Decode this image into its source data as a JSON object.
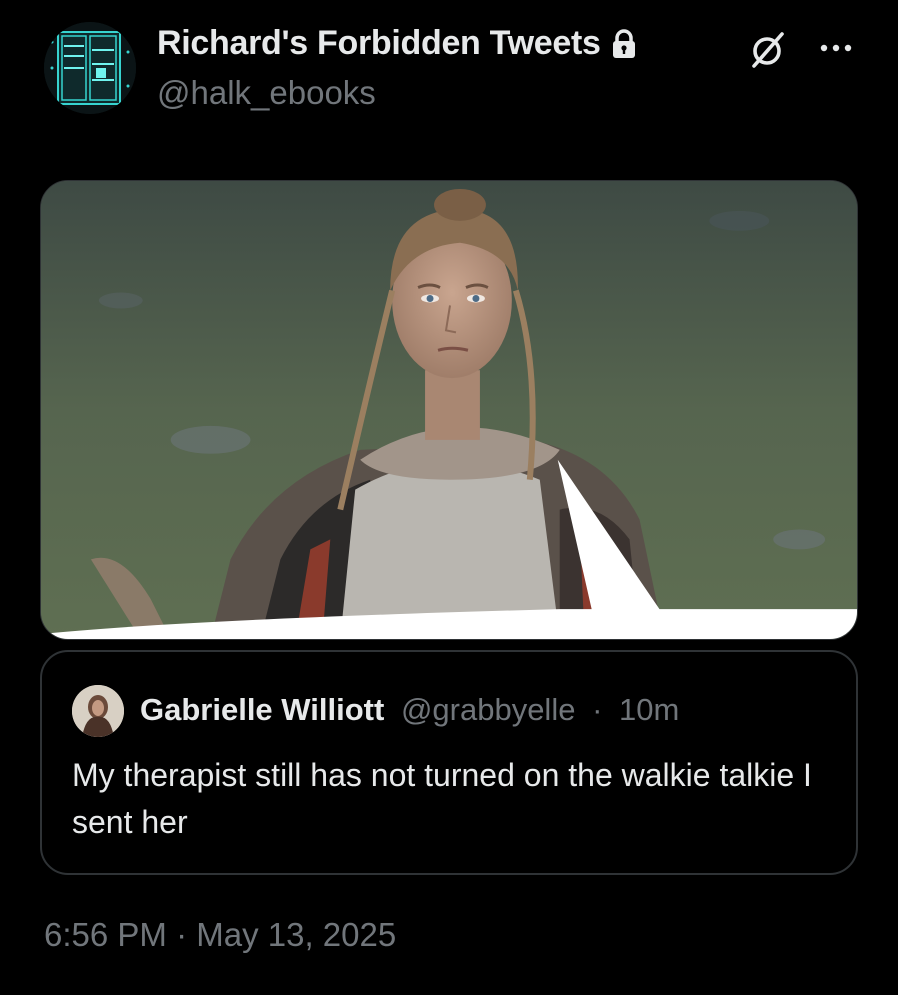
{
  "author": {
    "display_name": "Richard's Forbidden Tweets",
    "handle": "@halk_ebooks",
    "avatar_icon": "book-scan-avatar",
    "protected_icon": "lock-icon"
  },
  "actions": {
    "grok_icon": "grok-icon",
    "more_icon": "more-icon"
  },
  "media": {
    "type": "image",
    "speech_bubble_icon": "speech-bubble-tail"
  },
  "quoted_tweet": {
    "display_name": "Gabrielle Williott",
    "handle": "@grabbyelle",
    "separator": "·",
    "time": "10m",
    "text": "My therapist still has not turned on the walkie talkie I sent her"
  },
  "timestamp": "6:56 PM · May 13, 2025",
  "colors": {
    "background": "#000000",
    "text_primary": "#e7e9ea",
    "text_secondary": "#71767b",
    "border": "#2f3336"
  }
}
